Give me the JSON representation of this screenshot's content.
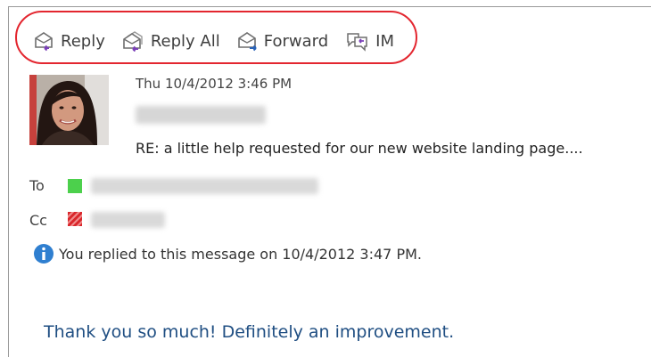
{
  "toolbar": {
    "actions": [
      {
        "label": "Reply",
        "icon": "reply-icon"
      },
      {
        "label": "Reply All",
        "icon": "reply-all-icon"
      },
      {
        "label": "Forward",
        "icon": "forward-icon"
      },
      {
        "label": "IM",
        "icon": "im-icon"
      }
    ],
    "highlight_color": "#e3262f"
  },
  "message": {
    "timestamp": "Thu 10/4/2012 3:46 PM",
    "subject": "RE: a little help requested for our new website landing page....",
    "to_label": "To",
    "cc_label": "Cc",
    "info": "You replied to this message on 10/4/2012 3:47 PM.",
    "body": "Thank you so much! Definitely an improvement."
  },
  "colors": {
    "presence_to": "#4cd04c",
    "presence_cc": "#d9262b",
    "body_text": "#1f4e82",
    "info_icon": "#2f7fd0"
  }
}
